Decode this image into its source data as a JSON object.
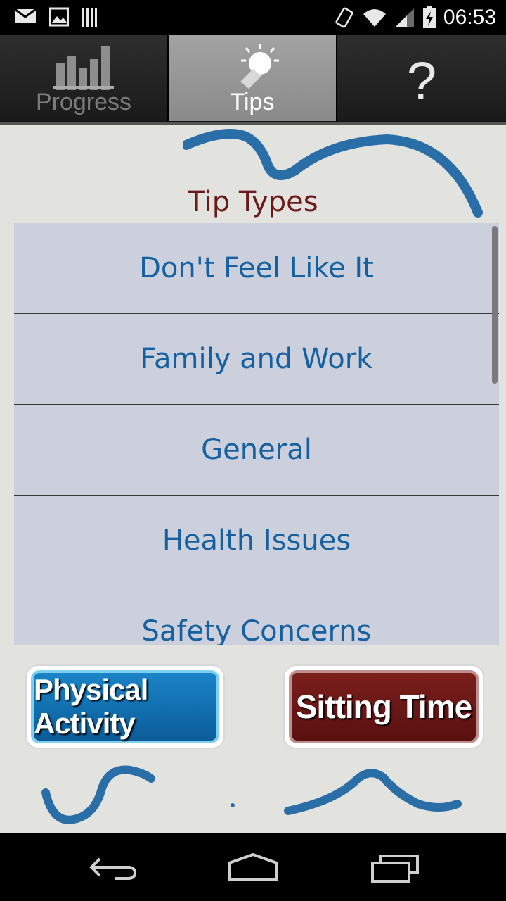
{
  "status_bar": {
    "time": "06:53",
    "icons": [
      "mail-icon",
      "image-icon",
      "barcode-icon",
      "rotate-icon",
      "wifi-icon",
      "signal-icon",
      "battery-charging-icon"
    ]
  },
  "tabs": [
    {
      "label": "Progress",
      "icon": "bar-chart-icon",
      "active": false
    },
    {
      "label": "Tips",
      "icon": "lightbulb-icon",
      "active": true
    },
    {
      "label": "?",
      "icon": "help-icon",
      "active": false
    }
  ],
  "tips": {
    "title": "Tip Types",
    "items": [
      "Don't Feel Like It",
      "Family and Work",
      "General",
      "Health Issues",
      "Safety Concerns"
    ]
  },
  "buttons": {
    "physical_activity": "Physical Activity",
    "sitting_time": "Sitting Time"
  },
  "nav": {
    "icons": [
      "back-icon",
      "home-icon",
      "recents-icon"
    ]
  },
  "colors": {
    "accent_blue": "#1560a0",
    "title_red": "#6b1a1a",
    "list_bg": "#ccd0dc"
  }
}
